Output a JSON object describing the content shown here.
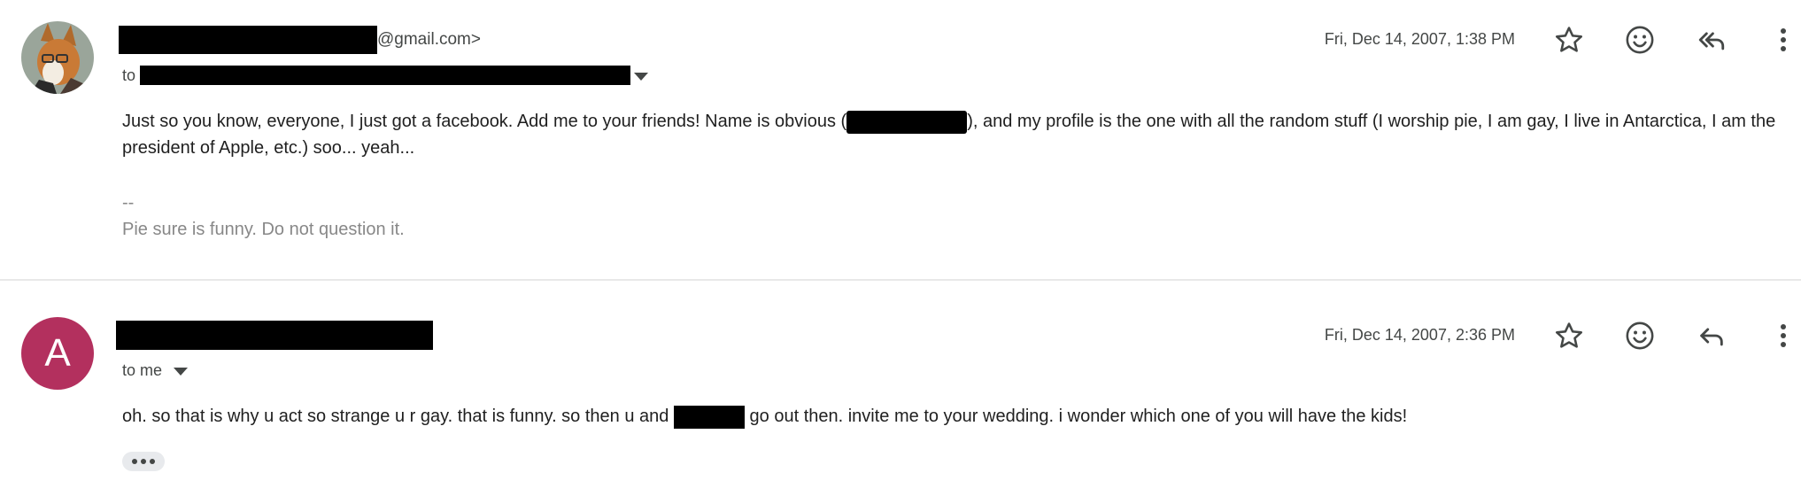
{
  "messages": [
    {
      "sender_suffix": "@gmail.com>",
      "to_prefix": "to",
      "date": "Fri, Dec 14, 2007, 1:38 PM",
      "body_part1": "Just so you know, everyone, I just got a facebook. Add me to your friends! Name is obvious (",
      "body_part2": "), and my profile is the one with all the random stuff (I worship pie, I am gay, I live in Antarctica, I am the",
      "body_line2": "president of Apple, etc.) soo... yeah...",
      "sig_dashes": "--",
      "signature": "Pie sure is funny. Do not question it.",
      "reply_icon": "reply-all-icon"
    },
    {
      "avatar_letter": "A",
      "avatar_color": "#b3305e",
      "to_label": "to me",
      "date": "Fri, Dec 14, 2007, 2:36 PM",
      "body_part1": "oh. so that is why u act so strange u r gay. that is funny. so then u and",
      "body_part2": "go out then. invite me to your wedding. i wonder which one of you will have the kids!",
      "reply_icon": "reply-icon"
    }
  ]
}
